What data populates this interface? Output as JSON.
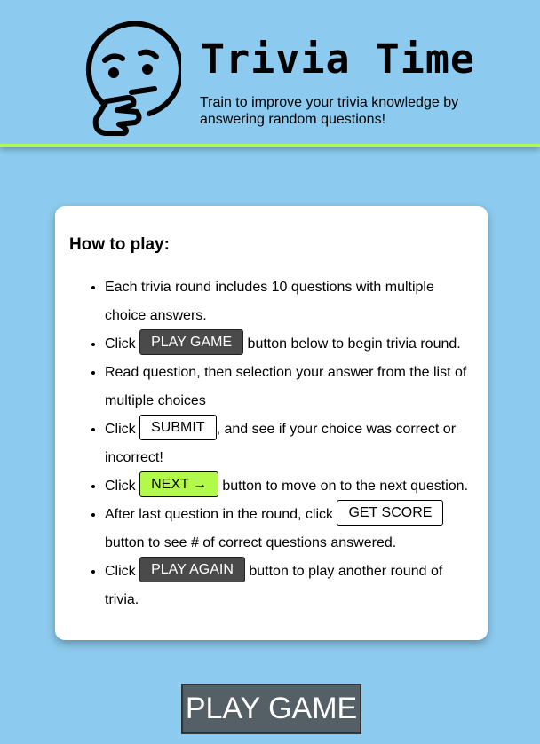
{
  "header": {
    "title": "Trivia Time",
    "subtitle": "Train to improve your trivia knowledge by answering random questions!",
    "logo_icon": "thinking-face-icon",
    "accent_color": "#b3f94a",
    "background_color": "#8ccbef"
  },
  "instructions": {
    "heading": "How to play:",
    "steps": [
      {
        "text": "Each trivia round includes 10 questions with multiple choice answers."
      },
      {
        "before": "Click ",
        "button": "PLAY GAME",
        "after": " button below to begin trivia round."
      },
      {
        "text": "Read question, then selection your answer from the list of multiple choices"
      },
      {
        "before": "Click ",
        "button": "SUBMIT",
        "after": ", and see if your choice was correct or incorrect!"
      },
      {
        "before": "Click ",
        "button": "NEXT →",
        "after": " button to move on to the next question."
      },
      {
        "before": "After last question in the round, click ",
        "button": "GET SCORE",
        "after": " button to see # of correct questions answered."
      },
      {
        "before": "Click ",
        "button": "PLAY AGAIN",
        "after": " button to play another round of trivia."
      }
    ]
  },
  "play_button": {
    "label": "PLAY GAME"
  }
}
